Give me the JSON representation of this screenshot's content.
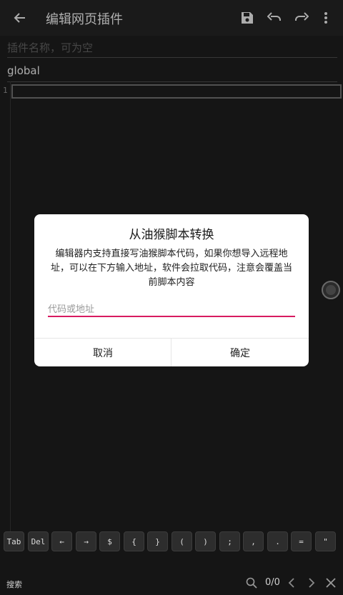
{
  "appbar": {
    "title": "编辑网页插件",
    "icons": [
      "back-arrow-icon",
      "save-icon",
      "undo-icon",
      "redo-icon",
      "more-vert-icon"
    ]
  },
  "form": {
    "name_placeholder": "插件名称，可为空",
    "scope_value": "global"
  },
  "editor": {
    "line_numbers": [
      "1"
    ]
  },
  "dialog": {
    "title": "从油猴脚本转换",
    "message": "编辑器内支持直接写油猴脚本代码，如果你想导入远程地址，可以在下方输入地址，软件会拉取代码，注意会覆盖当前脚本内容",
    "input_placeholder": "代码或地址",
    "cancel_label": "取消",
    "ok_label": "确定"
  },
  "keys": [
    "Tab",
    "Del",
    "←",
    "→",
    "$",
    "{",
    "}",
    "(",
    ")",
    ";",
    ",",
    ".",
    "=",
    "\""
  ],
  "searchbar": {
    "label": "搜索",
    "count": "0/0"
  },
  "colors": {
    "accent": "#d81b60",
    "background": "#1c1c1c",
    "dialog_bg": "#ffffff"
  }
}
